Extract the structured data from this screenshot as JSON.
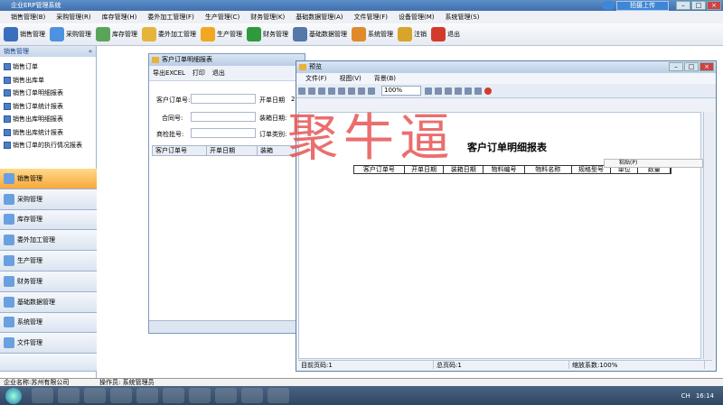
{
  "app": {
    "title": "企业ERP管理系统",
    "upload": "拍摄上传"
  },
  "menu": [
    "销售管理(B)",
    "采购管理(R)",
    "库存管理(H)",
    "委外加工管理(F)",
    "生产管理(C)",
    "财务管理(K)",
    "基础数据管理(A)",
    "文件管理(F)",
    "设备管理(M)",
    "系统管理(S)"
  ],
  "toolbar": [
    {
      "label": "销售管理",
      "icon": "pencil-icon",
      "color": "#3b6fbd"
    },
    {
      "label": "采购管理",
      "icon": "cart-icon",
      "color": "#4c92e0"
    },
    {
      "label": "库存管理",
      "icon": "box-icon",
      "color": "#5aa45a"
    },
    {
      "label": "委外加工管理",
      "icon": "folder-icon",
      "color": "#e6b43b"
    },
    {
      "label": "生产管理",
      "icon": "gear-icon",
      "color": "#f0a820"
    },
    {
      "label": "财务管理",
      "icon": "money-icon",
      "color": "#2f9a3c"
    },
    {
      "label": "基础数据管理",
      "icon": "grid-icon",
      "color": "#5577aa"
    },
    {
      "label": "系统管理",
      "icon": "user-icon",
      "color": "#e08a2b"
    },
    {
      "label": "注销",
      "icon": "key-icon",
      "color": "#d8a52b"
    },
    {
      "label": "退出",
      "icon": "close-icon",
      "color": "#d23b2b"
    }
  ],
  "sidebar": {
    "title": "销售管理",
    "collapse": "«",
    "items": [
      "销售订单",
      "销售出库单",
      "销售订单明细报表",
      "销售订单统计报表",
      "销售出库明细报表",
      "销售出库统计报表",
      "销售订单的执行情况报表"
    ],
    "nav": [
      "销售管理",
      "采购管理",
      "库存管理",
      "委外加工管理",
      "生产管理",
      "财务管理",
      "基础数据管理",
      "系统管理",
      "文件管理"
    ]
  },
  "win1": {
    "title": "客户订单明细报表",
    "export": "导出EXCEL",
    "print": "打印",
    "exit": "退出",
    "fields": {
      "customer_order": "客户订单号:",
      "contract": "合同号:",
      "batch": "商检批号:",
      "open_date": "开单日期",
      "ship_date": "装箱日期:",
      "order_type": "订单类别:",
      "prefix": "2"
    },
    "columns": [
      "客户订单号",
      "开单日期",
      "装箱"
    ]
  },
  "win2": {
    "title": "预览",
    "menu": [
      "文件(F)",
      "视图(V)",
      "背景(B)"
    ],
    "zoom": "100%",
    "report_title": "客户订单明细报表",
    "columns": [
      "客户订单号",
      "开单日期",
      "装箱日期",
      "物料编号",
      "物料名称",
      "规格型号",
      "单位",
      "数量"
    ],
    "paste": "粘贴(P)",
    "status": {
      "page": "目前页码:1",
      "total": "总页码:1",
      "scale": "缩放系数:100%"
    }
  },
  "watermark": "聚牛逼",
  "footer": {
    "company": "企业名称:苏州有限公司",
    "operator": "操作员: 系统管理员"
  },
  "tray": {
    "lang": "CH",
    "time": "16:14"
  }
}
